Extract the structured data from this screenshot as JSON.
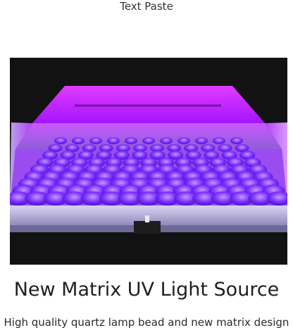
{
  "header": {
    "link_label": "Text Paste"
  },
  "hero": {
    "glow_color": "#c020ff",
    "led_color": "#7a2cff",
    "background": "#121212"
  },
  "product": {
    "title": "New Matrix UV Light Source",
    "description": "High quality quartz lamp bead and new matrix design"
  }
}
